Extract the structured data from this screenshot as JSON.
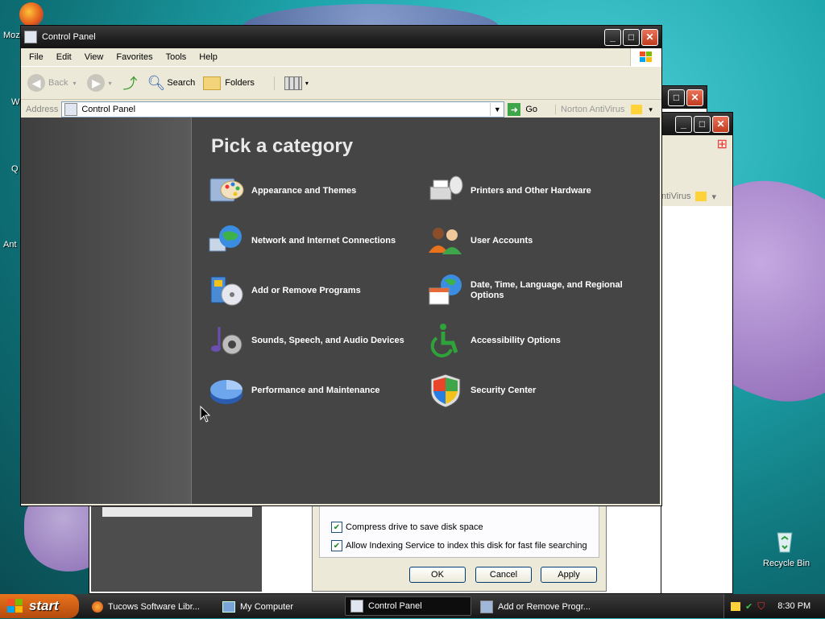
{
  "desktop": {
    "partial_labels": [
      "Moz",
      "W",
      "Q",
      "Ant"
    ],
    "recycle_bin_label": "Recycle Bin"
  },
  "control_panel": {
    "title": "Control Panel",
    "menu": [
      "File",
      "Edit",
      "View",
      "Favorites",
      "Tools",
      "Help"
    ],
    "toolbar": {
      "back": "Back",
      "search": "Search",
      "folders": "Folders"
    },
    "address": {
      "label": "Address",
      "value": "Control Panel",
      "go": "Go",
      "norton": "Norton AntiVirus"
    },
    "heading": "Pick a category",
    "categories": [
      {
        "label": "Appearance and Themes",
        "icon": "appearance-themes-icon"
      },
      {
        "label": "Printers and Other Hardware",
        "icon": "printer-icon"
      },
      {
        "label": "Network and Internet Connections",
        "icon": "network-globe-icon"
      },
      {
        "label": "User Accounts",
        "icon": "user-accounts-icon"
      },
      {
        "label": "Add or Remove Programs",
        "icon": "add-remove-programs-icon"
      },
      {
        "label": "Date, Time, Language, and Regional Options",
        "icon": "calendar-globe-icon"
      },
      {
        "label": "Sounds, Speech, and Audio Devices",
        "icon": "sound-icon"
      },
      {
        "label": "Accessibility Options",
        "icon": "accessibility-icon"
      },
      {
        "label": "Performance and Maintenance",
        "icon": "performance-pie-icon"
      },
      {
        "label": "Security Center",
        "icon": "security-shield-icon"
      }
    ]
  },
  "back_window": {
    "norton_partial": "ntiVirus"
  },
  "properties_dialog": {
    "compress": "Compress drive to save disk space",
    "indexing": "Allow Indexing Service to index this disk for fast file searching",
    "ok": "OK",
    "cancel": "Cancel",
    "apply": "Apply"
  },
  "taskbar": {
    "start": "start",
    "tasks": [
      "Tucows Software Libr...",
      "My Computer",
      "Control Panel",
      "Add or Remove Progr..."
    ],
    "active_task": "Control Panel",
    "clock": "8:30 PM"
  }
}
